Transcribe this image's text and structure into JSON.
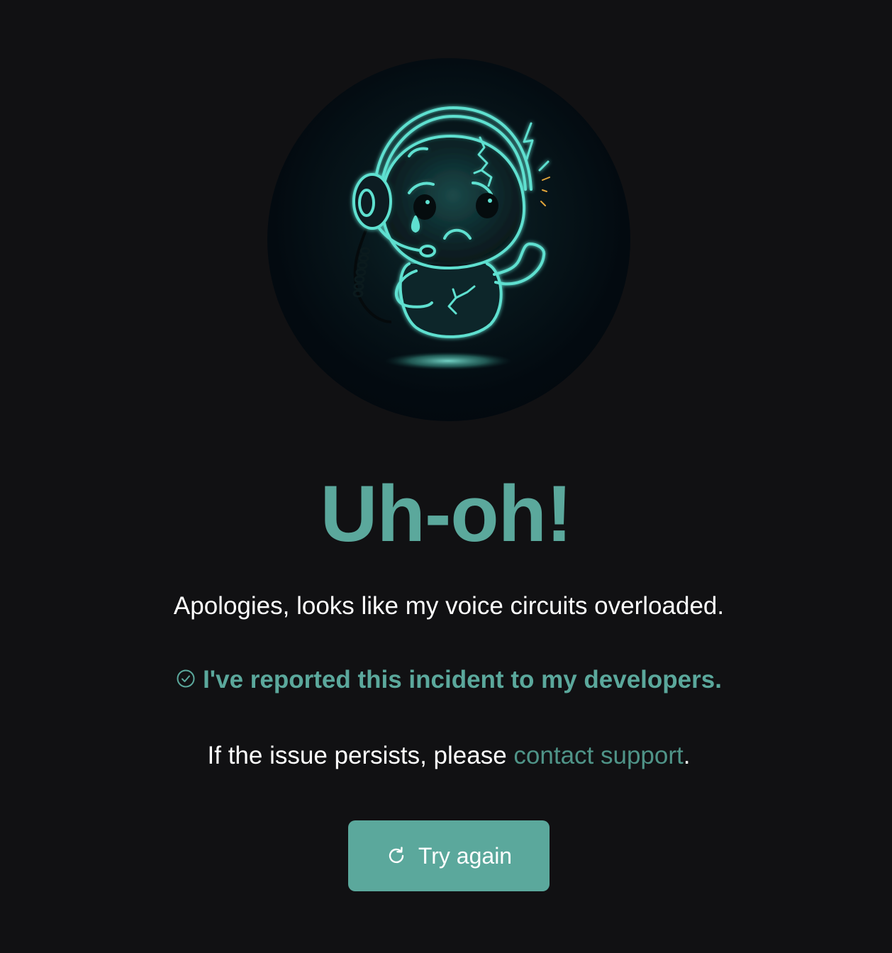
{
  "error": {
    "title": "Uh-oh!",
    "message": "Apologies, looks like my voice circuits overloaded.",
    "reported": "I've reported this incident to my developers.",
    "persist_prefix": "If the issue persists, please ",
    "contact_link": "contact support",
    "persist_suffix": ".",
    "retry_label": "Try again"
  },
  "icons": {
    "illustration": "sad-robot-headset-illustration",
    "reported": "check-circle-icon",
    "retry": "refresh-icon"
  },
  "colors": {
    "background": "#111113",
    "accent": "#5ba89c",
    "link": "#4f9488",
    "text": "#ffffff",
    "glow": "#5ee0d0"
  }
}
